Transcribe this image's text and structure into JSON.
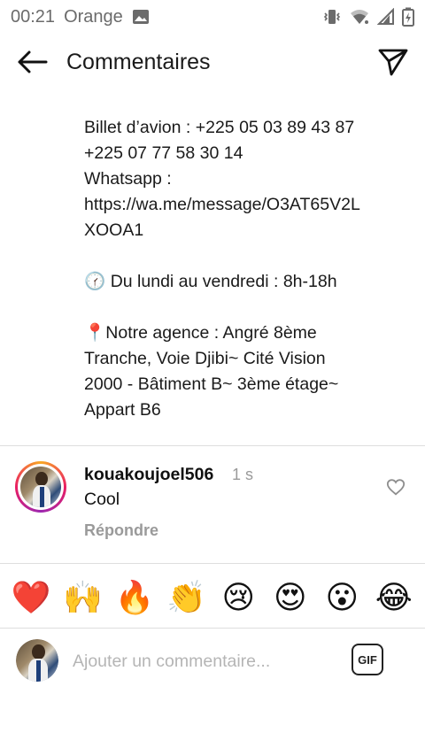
{
  "status_bar": {
    "time": "00:21",
    "carrier": "Orange"
  },
  "header": {
    "title": "Commentaires"
  },
  "caption": {
    "lines": [
      "Billet d’avion : +225 05 03 89 43 87",
      "+225 07 77 58 30 14",
      "Whatsapp : https://wa.me/message/O3AT65V2LXOOA1",
      "",
      "🕜 Du lundi au vendredi : 8h-18h",
      "",
      "📍Notre agence : Angré 8ème Tranche, Voie Djibi~ Cité Vision 2000 - Bâtiment B~ 3ème étage~ Appart B6"
    ]
  },
  "comment": {
    "username": "kouakoujoel506",
    "time": "1 s",
    "text": "Cool",
    "reply_label": "Répondre"
  },
  "reactions": [
    "❤️",
    "🙌",
    "🔥",
    "👏",
    "😢",
    "😍",
    "😮",
    "😂"
  ],
  "composer": {
    "placeholder": "Ajouter un commentaire...",
    "gif_label": "GIF"
  },
  "colors": {
    "muted_text": "#9a9a9a",
    "divider": "#dedede",
    "ring_gradient": [
      "#f9a825",
      "#e91e63",
      "#9c27b0"
    ]
  }
}
